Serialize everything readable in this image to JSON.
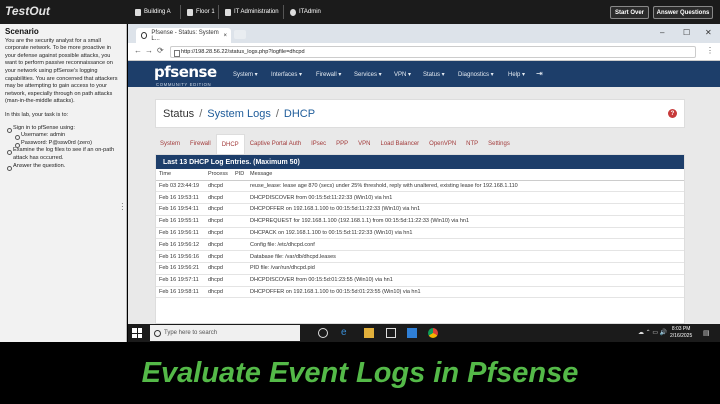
{
  "topbar": {
    "logo": "TestOut",
    "crumbs": [
      "Building A",
      "Floor 1",
      "IT Administration",
      "ITAdmin"
    ],
    "start_over": "Start Over",
    "answer_questions": "Answer Questions"
  },
  "scenario": {
    "title": "Scenario",
    "intro": "You are the security analyst for a small corporate network. To be more proactive in your defense against possible attacks, you want to perform passive reconnaissance on your network using pfSense's logging capabilities. You are concerned that attackers may be attempting to gain access to your network, especially through on path attacks (man-in-the-middle attacks).",
    "task_heading": "In this lab, your task is to:",
    "tasks": [
      "Sign in to pfSense using:",
      "Username: admin",
      "Password: P@ssw0rd (zero)",
      "Examine the log files to see if an on-path attack has occurred.",
      "Answer the question."
    ]
  },
  "browser": {
    "tab_title": "Pfsense - Status: System L...",
    "url": "http://198.28.56.22/status_logs.php?logfile=dhcpd"
  },
  "pfsense": {
    "brand": "pf",
    "brand2": "sense",
    "edition": "COMMUNITY EDITION",
    "menu": [
      "System ▾",
      "Interfaces ▾",
      "Firewall ▾",
      "Services ▾",
      "VPN ▾",
      "Status ▾",
      "Diagnostics ▾",
      "Help ▾"
    ],
    "breadcrumb": {
      "status": "Status",
      "logs": "System Logs",
      "dhcp": "DHCP",
      "sep": "/"
    },
    "help": "?",
    "tabs": [
      "System",
      "Firewall",
      "DHCP",
      "Captive Portal Auth",
      "IPsec",
      "PPP",
      "VPN",
      "Load Balancer",
      "OpenVPN",
      "NTP",
      "Settings"
    ],
    "active_tab": "DHCP",
    "panel_title": "Last 13 DHCP Log Entries. (Maximum 50)",
    "columns": [
      "Time",
      "Process",
      "PID",
      "Message"
    ],
    "rows": [
      [
        "Feb 03 23:44:19",
        "dhcpd",
        "",
        "reuse_lease: lease age 870 (secs) under 25% threshold, reply with unaltered, existing lease for 192.168.1.110"
      ],
      [
        "Feb 16 19:53:11",
        "dhcpd",
        "",
        "DHCPDISCOVER from 00:15:5d:11:22:33 (Win10) via hn1"
      ],
      [
        "Feb 16 19:54:11",
        "dhcpd",
        "",
        "DHCPOFFER on 192.168.1.100 to 00:15:5d:11:22:33 (Win10) via hn1"
      ],
      [
        "Feb 16 19:55:11",
        "dhcpd",
        "",
        "DHCPREQUEST for 192.168.1.100 (192.168.1.1) from 00:15:5d:11:22:33 (Win10) via hn1"
      ],
      [
        "Feb 16 19:56:11",
        "dhcpd",
        "",
        "DHCPACK on 192.168.1.100 to 00:15:5d:11:22:33 (Win10) via hn1"
      ],
      [
        "Feb 16 19:56:12",
        "dhcpd",
        "",
        "Config file: /etc/dhcpd.conf"
      ],
      [
        "Feb 16 19:56:16",
        "dhcpd",
        "",
        "Database file: /var/db/dhcpd.leases"
      ],
      [
        "Feb 16 19:56:21",
        "dhcpd",
        "",
        "PID file: /var/run/dhcpd.pid"
      ],
      [
        "Feb 16 19:57:11",
        "dhcpd",
        "",
        "DHCPDISCOVER from 00:15:5d:01:23:55 (Win10) via hn1"
      ],
      [
        "Feb 16 19:58:11",
        "dhcpd",
        "",
        "DHCPOFFER on 192.168.1.100 to 00:15:5d:01:23:55 (Win10) via hn1"
      ]
    ]
  },
  "taskbar": {
    "search": "Type here to search",
    "time": "8:03 PM",
    "date": "2/16/2025"
  },
  "caption": "Evaluate Event Logs in Pfsense",
  "colors": {
    "pfsense_nav": "#1d3e6a",
    "caption": "#54b948",
    "tab_link": "#a23b3b"
  }
}
